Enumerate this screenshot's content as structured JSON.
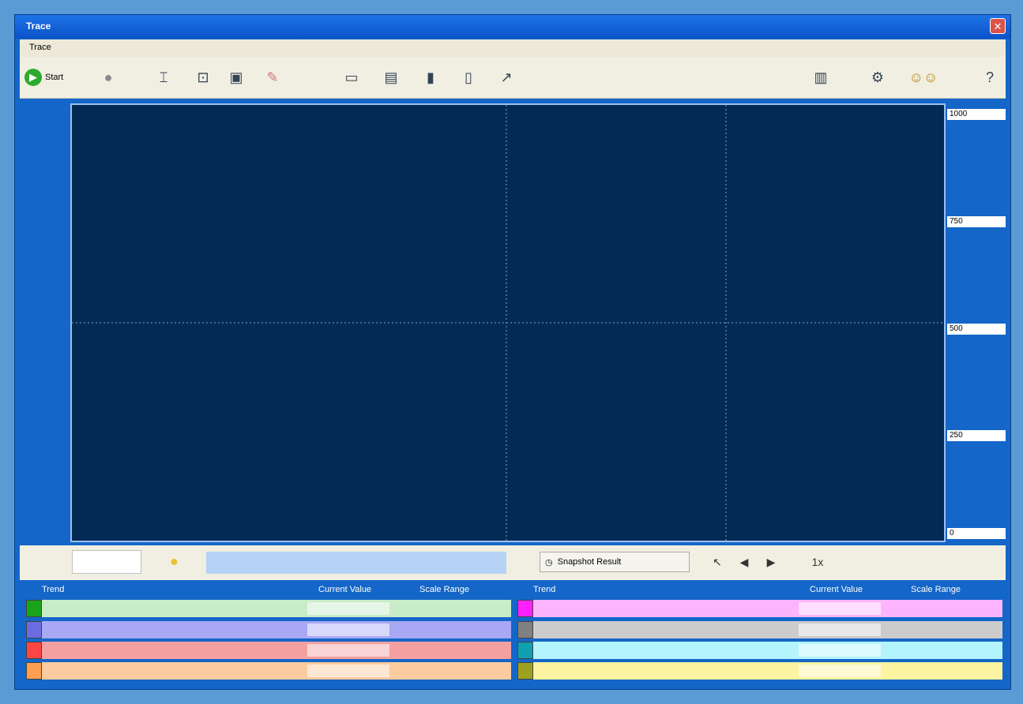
{
  "window": {
    "title": "Trace"
  },
  "menu": {
    "items": [
      "Trace"
    ]
  },
  "toolbar": {
    "start_label": "Start"
  },
  "plot": {
    "y_labels": [
      "1000",
      "750",
      "500",
      "250",
      "0"
    ]
  },
  "snapshot": {
    "label": "Snapshot Result",
    "speed": "1x"
  },
  "legend": {
    "left_headers": [
      "Trend",
      "Current Value",
      "Scale Range"
    ],
    "right_headers": [
      "Trend",
      "Current Value",
      "Scale Range"
    ],
    "left_colors": [
      "#19a319",
      "#6c6ce0",
      "#ff4444",
      "#ff9f50"
    ],
    "left_bgs": [
      "#c8ecc8",
      "#a8a8f4",
      "#f4a0a0",
      "#fccca0"
    ],
    "right_colors": [
      "#ff20ff",
      "#808080",
      "#10a0b0",
      "#a0a020"
    ],
    "right_bgs": [
      "#fcb4fc",
      "#cccccc",
      "#b4f4fc",
      "#fcf4a0"
    ]
  }
}
